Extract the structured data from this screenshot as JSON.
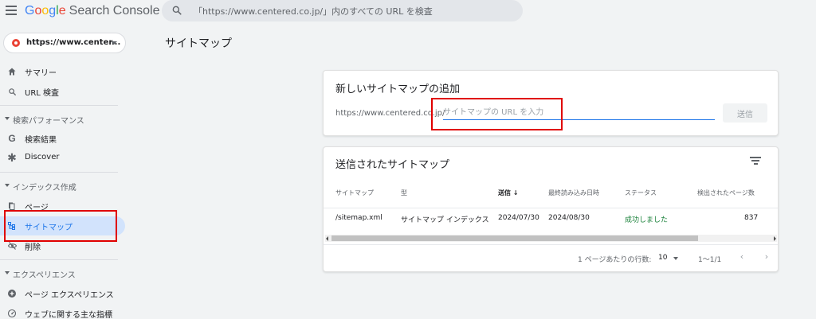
{
  "header": {
    "logo_letters": [
      "G",
      "o",
      "o",
      "g",
      "l",
      "e"
    ],
    "logo_rest": "Search Console",
    "search_placeholder": "「https://www.centered.co.jp/」内のすべての URL を検査"
  },
  "sidebar": {
    "property": "https://www.center...",
    "items": [
      {
        "label": "サマリー",
        "icon": "home-icon"
      },
      {
        "label": "URL 検査",
        "icon": "search-icon"
      }
    ],
    "section_performance": "検索パフォーマンス",
    "performance_items": [
      {
        "label": "検索結果",
        "icon": "google-g-icon"
      },
      {
        "label": "Discover",
        "icon": "asterisk-icon"
      }
    ],
    "section_index": "インデックス作成",
    "index_items": [
      {
        "label": "ページ",
        "icon": "pages-icon"
      },
      {
        "label": "サイトマップ",
        "icon": "sitemap-icon",
        "active": true
      },
      {
        "label": "削除",
        "icon": "eye-off-icon"
      }
    ],
    "section_experience": "エクスペリエンス",
    "experience_items": [
      {
        "label": "ページ エクスペリエンス",
        "icon": "plus-circle-icon"
      },
      {
        "label": "ウェブに関する主な指標",
        "icon": "gauge-icon"
      }
    ]
  },
  "main": {
    "page_title": "サイトマップ",
    "add_card": {
      "title": "新しいサイトマップの追加",
      "url_prefix": "https://www.centered.co.jp/",
      "input_placeholder": "サイトマップの URL を入力",
      "input_value": "",
      "submit_label": "送信"
    },
    "submitted_card": {
      "title": "送信されたサイトマップ",
      "columns": [
        "サイトマップ",
        "型",
        "送信",
        "最終読み込み日時",
        "ステータス",
        "検出されたページ数"
      ],
      "sort_arrow": "↓",
      "rows": [
        [
          "/sitemap.xml",
          "サイトマップ インデックス",
          "2024/07/30",
          "2024/08/30",
          "成功しました",
          "837"
        ]
      ],
      "rows_per_page_label": "1 ページあたりの行数:",
      "rows_per_page_value": "10",
      "range": "1〜1/1"
    }
  },
  "colors": {
    "accent": "#1a73e8",
    "status_success": "#188038",
    "highlight_box": "#e00000",
    "active_nav_bg": "#d2e3fc"
  }
}
